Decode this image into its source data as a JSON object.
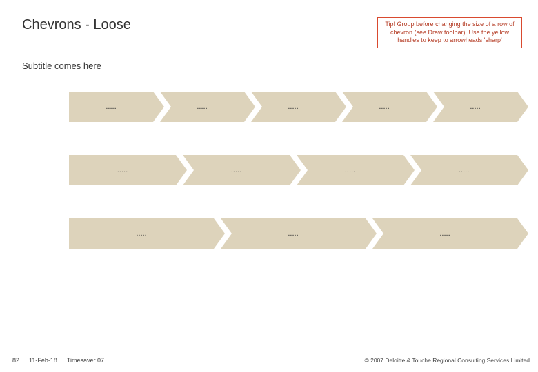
{
  "header": {
    "title": "Chevrons - Loose",
    "tip": "Tip! Group before changing the size of a row of chevron (see Draw toolbar). Use the yellow handles to keep to arrowheads 'sharp'"
  },
  "subtitle": "Subtitle comes here",
  "rows": [
    {
      "items": [
        ".....",
        ".....",
        ".....",
        ".....",
        "....."
      ]
    },
    {
      "items": [
        ".....",
        ".....",
        ".....",
        "....."
      ]
    },
    {
      "items": [
        ".....",
        ".....",
        "....."
      ]
    }
  ],
  "footer": {
    "page": "82",
    "date": "11-Feb-18",
    "project": "Timesaver 07",
    "copyright": "© 2007 Deloitte & Touche Regional Consulting Services Limited"
  }
}
